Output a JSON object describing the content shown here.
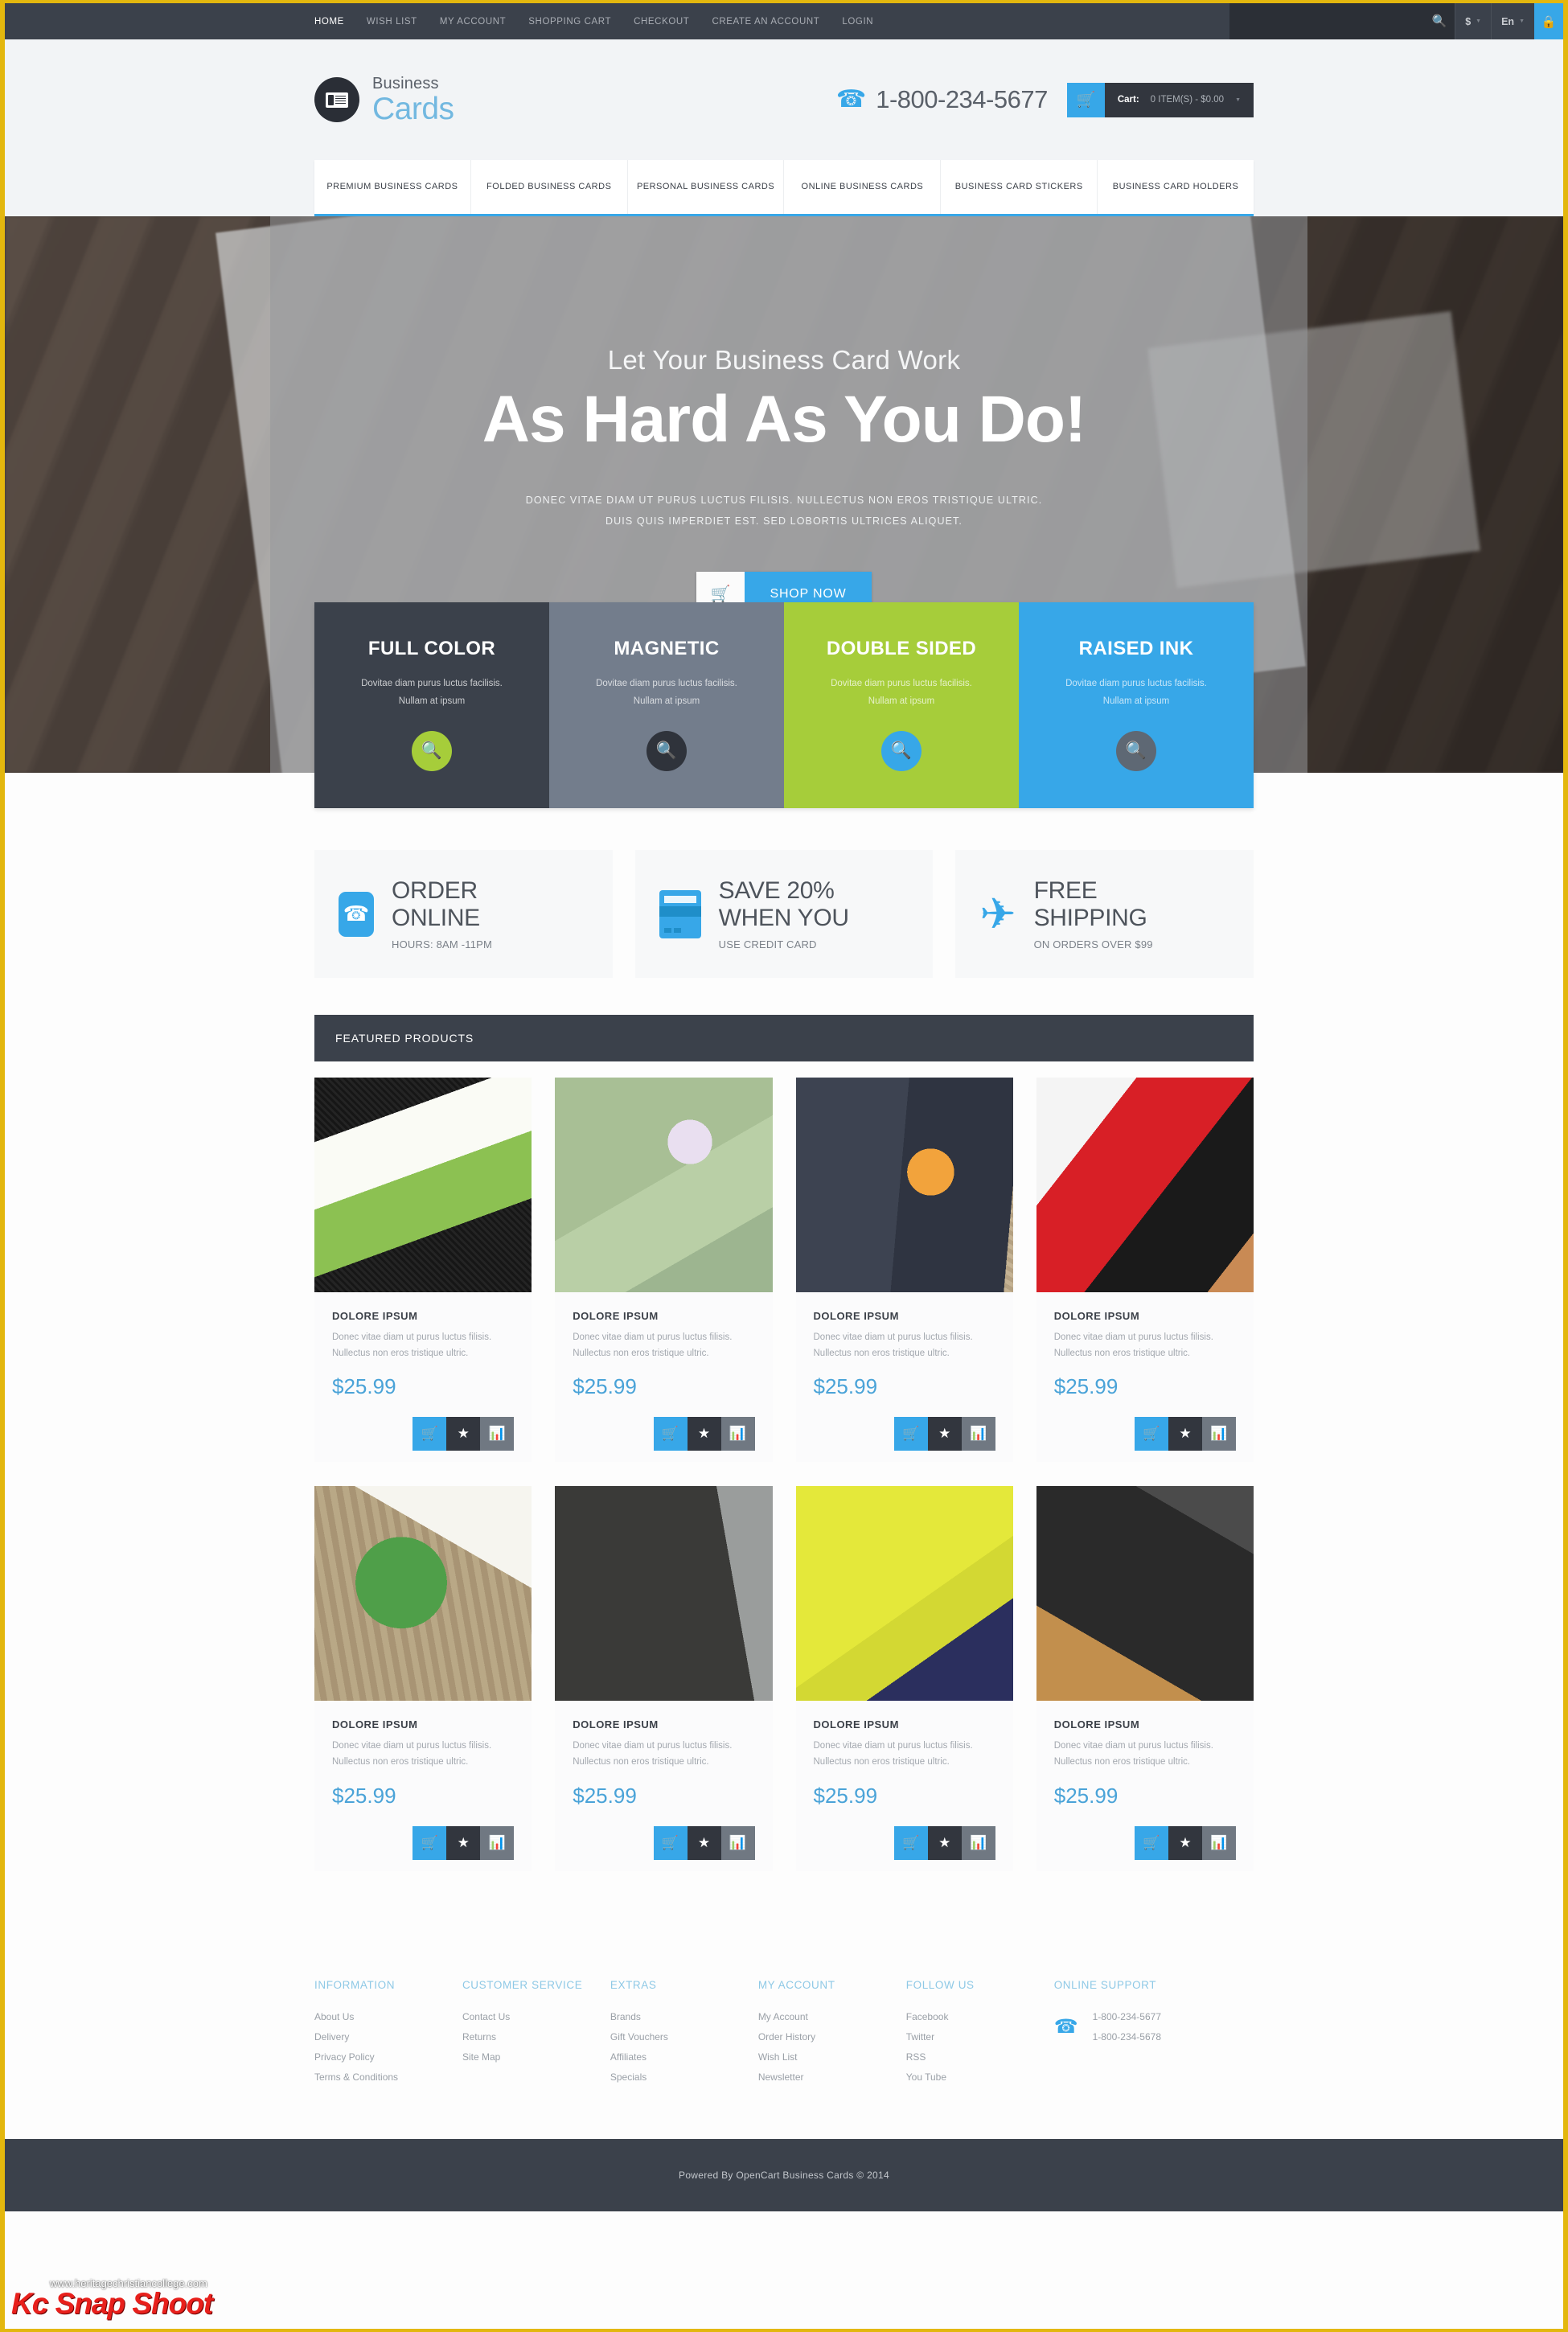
{
  "topbar": {
    "nav": [
      {
        "label": "HOME",
        "active": true
      },
      {
        "label": "WISH LIST",
        "active": false
      },
      {
        "label": "MY ACCOUNT",
        "active": false
      },
      {
        "label": "SHOPPING CART",
        "active": false
      },
      {
        "label": "CHECKOUT",
        "active": false
      },
      {
        "label": "CREATE AN ACCOUNT",
        "active": false
      },
      {
        "label": "LOGIN",
        "active": false
      }
    ],
    "search_value": "",
    "search_placeholder": "",
    "currency": "$",
    "language": "En",
    "lock_icon": "lock-icon"
  },
  "header": {
    "logo_line1": "Business",
    "logo_line2": "Cards",
    "phone": "1-800-234-5677",
    "cart_label": "Cart:",
    "cart_value": "0 ITEM(S) - $0.00"
  },
  "mainnav": [
    "PREMIUM BUSINESS CARDS",
    "FOLDED BUSINESS CARDS",
    "PERSONAL BUSINESS CARDS",
    "ONLINE BUSINESS CARDS",
    "BUSINESS CARD STICKERS",
    "BUSINESS CARD HOLDERS"
  ],
  "hero": {
    "subtitle": "Let Your Business Card Work",
    "title": "As Hard As You Do!",
    "desc_line1": "DONEC VITAE DIAM UT PURUS LUCTUS FILISIS. NULLECTUS NON EROS TRISTIQUE ULTRIC.",
    "desc_line2": "DUIS QUIS IMPERDIET EST. SED LOBORTIS ULTRICES ALIQUET.",
    "cta": "SHOP NOW"
  },
  "tiles": [
    {
      "title": "FULL COLOR",
      "desc_line1": "Dovitae diam purus luctus facilisis.",
      "desc_line2": "Nullam at ipsum",
      "bg": "#3b414b",
      "btn_bg": "#a6cd3a"
    },
    {
      "title": "MAGNETIC",
      "desc_line1": "Dovitae diam purus luctus facilisis.",
      "desc_line2": "Nullam at ipsum",
      "bg": "#737d8c",
      "btn_bg": "#2f333b"
    },
    {
      "title": "DOUBLE SIDED",
      "desc_line1": "Dovitae diam purus luctus facilisis.",
      "desc_line2": "Nullam at ipsum",
      "bg": "#a6cd3a",
      "btn_bg": "#37a7e8"
    },
    {
      "title": "RAISED INK",
      "desc_line1": "Dovitae diam purus luctus facilisis.",
      "desc_line2": "Nullam at ipsum",
      "bg": "#37a7e8",
      "btn_bg": "#5e6874"
    }
  ],
  "benefits": [
    {
      "icon": "phone-icon",
      "title_line1": "ORDER",
      "title_line2": "ONLINE",
      "sub": "HOURS: 8AM -11PM"
    },
    {
      "icon": "credit-card-icon",
      "title_line1": "SAVE 20%",
      "title_line2": "WHEN YOU",
      "sub": "USE CREDIT CARD"
    },
    {
      "icon": "airplane-icon",
      "title_line1": "FREE",
      "title_line2": "SHIPPING",
      "sub": "ON ORDERS OVER $99"
    }
  ],
  "featured": {
    "heading": "FEATURED PRODUCTS",
    "products": [
      {
        "name": "DOLORE IPSUM",
        "desc": "Donec vitae diam ut purus luctus filisis. Nullectus non eros tristique ultric.",
        "price": "$25.99",
        "img": "img1"
      },
      {
        "name": "DOLORE IPSUM",
        "desc": "Donec vitae diam ut purus luctus filisis. Nullectus non eros tristique ultric.",
        "price": "$25.99",
        "img": "img2"
      },
      {
        "name": "DOLORE IPSUM",
        "desc": "Donec vitae diam ut purus luctus filisis. Nullectus non eros tristique ultric.",
        "price": "$25.99",
        "img": "img3"
      },
      {
        "name": "DOLORE IPSUM",
        "desc": "Donec vitae diam ut purus luctus filisis. Nullectus non eros tristique ultric.",
        "price": "$25.99",
        "img": "img4"
      },
      {
        "name": "DOLORE IPSUM",
        "desc": "Donec vitae diam ut purus luctus filisis. Nullectus non eros tristique ultric.",
        "price": "$25.99",
        "img": "img5"
      },
      {
        "name": "DOLORE IPSUM",
        "desc": "Donec vitae diam ut purus luctus filisis. Nullectus non eros tristique ultric.",
        "price": "$25.99",
        "img": "img6"
      },
      {
        "name": "DOLORE IPSUM",
        "desc": "Donec vitae diam ut purus luctus filisis. Nullectus non eros tristique ultric.",
        "price": "$25.99",
        "img": "img7"
      },
      {
        "name": "DOLORE IPSUM",
        "desc": "Donec vitae diam ut purus luctus filisis. Nullectus non eros tristique ultric.",
        "price": "$25.99",
        "img": "img8"
      }
    ]
  },
  "footer": {
    "columns": [
      {
        "heading": "INFORMATION",
        "links": [
          "About Us",
          "Delivery",
          "Privacy Policy",
          "Terms & Conditions"
        ]
      },
      {
        "heading": "CUSTOMER SERVICE",
        "links": [
          "Contact Us",
          "Returns",
          "Site Map"
        ]
      },
      {
        "heading": "EXTRAS",
        "links": [
          "Brands",
          "Gift Vouchers",
          "Affiliates",
          "Specials"
        ]
      },
      {
        "heading": "MY ACCOUNT",
        "links": [
          "My Account",
          "Order History",
          "Wish List",
          "Newsletter"
        ]
      },
      {
        "heading": "FOLLOW US",
        "links": [
          "Facebook",
          "Twitter",
          "RSS",
          "You Tube"
        ]
      }
    ],
    "support_heading": "ONLINE SUPPORT",
    "support_phone1": "1-800-234-5677",
    "support_phone2": "1-800-234-5678",
    "copyright": "Powered By OpenCart Business Cards © 2014"
  },
  "watermark": {
    "url": "www.heritagechristiancollege.com",
    "brand": "Kc Snap Shoot"
  },
  "colors": {
    "accent_blue": "#37a7e8",
    "dark": "#3b414b",
    "green": "#a6cd3a",
    "border_yellow": "#e3b70e",
    "price_blue": "#4aa3d8"
  }
}
